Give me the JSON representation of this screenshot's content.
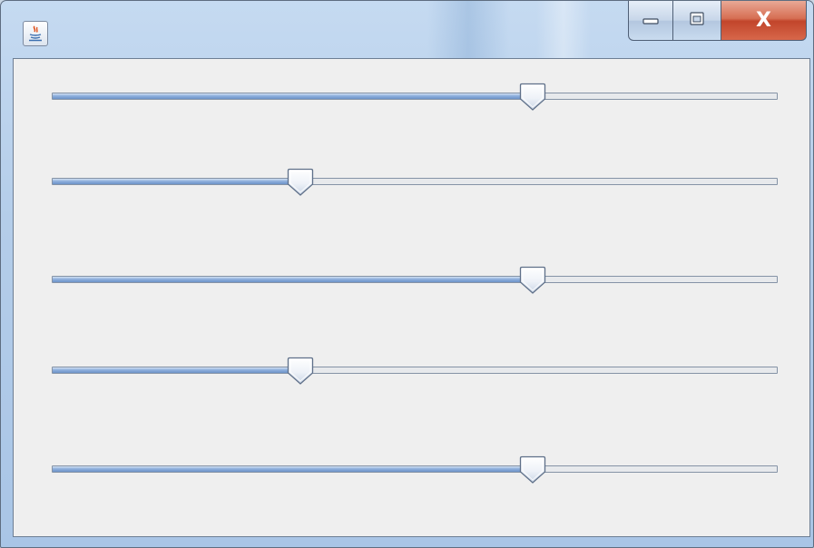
{
  "window": {
    "app_icon": "java-cup-icon",
    "caption_buttons": {
      "minimize_icon": "minimize-icon",
      "maximize_icon": "maximize-icon",
      "close_label": "X"
    }
  },
  "sliders": [
    {
      "value_fraction": 0.663
    },
    {
      "value_fraction": 0.342
    },
    {
      "value_fraction": 0.663
    },
    {
      "value_fraction": 0.342
    },
    {
      "value_fraction": 0.663
    }
  ],
  "colors": {
    "client_background": "#efefef",
    "track_fill": "#7fa4d6",
    "close_button": "#c94a30"
  }
}
